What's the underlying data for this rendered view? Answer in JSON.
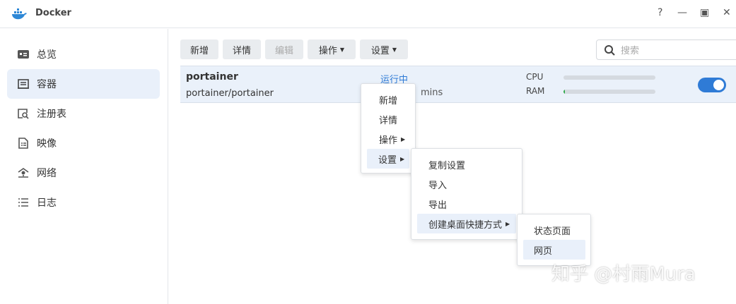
{
  "window": {
    "title": "Docker",
    "help": "?",
    "minimize": "—",
    "maximize": "▣",
    "close": "✕"
  },
  "sidebar": {
    "items": [
      {
        "label": "总览"
      },
      {
        "label": "容器"
      },
      {
        "label": "注册表"
      },
      {
        "label": "映像"
      },
      {
        "label": "网络"
      },
      {
        "label": "日志"
      }
    ]
  },
  "toolbar": {
    "new": "新增",
    "details": "详情",
    "edit": "编辑",
    "action": "操作",
    "settings": "设置",
    "search_placeholder": "搜索"
  },
  "container": {
    "name": "portainer",
    "image": "portainer/portainer",
    "status": "运行中",
    "uptime": "mins",
    "cpu_label": "CPU",
    "ram_label": "RAM",
    "cpu_percent": 0,
    "ram_percent": 1,
    "enabled": true
  },
  "context_menu": {
    "items": [
      "新增",
      "详情",
      "操作",
      "设置"
    ]
  },
  "settings_submenu": {
    "items": [
      "复制设置",
      "导入",
      "导出",
      "创建桌面快捷方式"
    ]
  },
  "shortcut_submenu": {
    "items": [
      "状态页面",
      "网页"
    ]
  },
  "watermark": "知乎 @村雨Mura",
  "colors": {
    "accent": "#2f7bd6",
    "selected": "#e9f0fa"
  }
}
